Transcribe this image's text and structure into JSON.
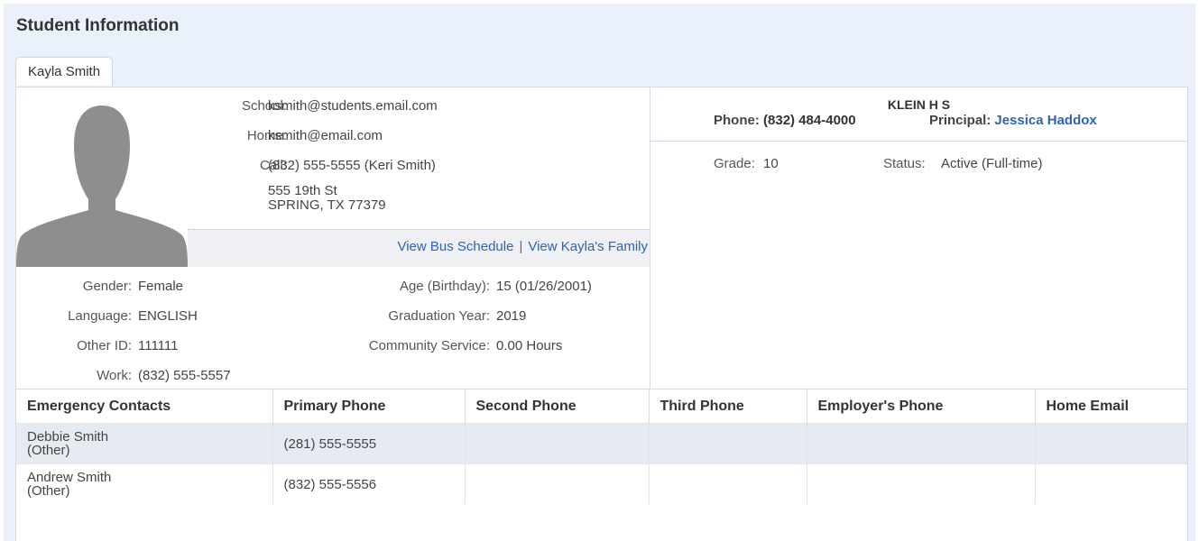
{
  "page_title": "Student Information",
  "tab": {
    "label": "Kayla Smith"
  },
  "contact": {
    "school_label": "School:",
    "school_value": "ksmith@students.email.com",
    "home_label": "Home:",
    "home_value": "ksmith@email.com",
    "call_label": "Call:",
    "call_value": "(832) 555-5555 (Keri Smith)",
    "address_line1": "555 19th St",
    "address_line2": "SPRING, TX 77379"
  },
  "links": {
    "bus_schedule": "View Bus Schedule",
    "separator": "|",
    "family": "View Kayla's Family"
  },
  "demographics": {
    "gender_label": "Gender:",
    "gender_value": "Female",
    "language_label": "Language:",
    "language_value": "ENGLISH",
    "other_id_label": "Other ID:",
    "other_id_value": "111111",
    "work_label": "Work:",
    "work_value": "(832) 555-5557",
    "age_label": "Age (Birthday):",
    "age_value": "15 (01/26/2001)",
    "grad_label": "Graduation Year:",
    "grad_value": "2019",
    "service_label": "Community Service:",
    "service_value": "0.00 Hours"
  },
  "school": {
    "name": "KLEIN H S",
    "phone_label": "Phone:",
    "phone_value": "(832) 484-4000",
    "principal_label": "Principal:",
    "principal_value": "Jessica Haddox"
  },
  "enrollment": {
    "grade_label": "Grade:",
    "grade_value": "10",
    "status_label": "Status:",
    "status_value": "Active (Full-time)"
  },
  "contacts_table": {
    "headers": [
      "Emergency Contacts",
      "Primary Phone",
      "Second Phone",
      "Third Phone",
      "Employer's Phone",
      "Home Email"
    ],
    "rows": [
      {
        "name": "Debbie Smith",
        "relation": "(Other)",
        "primary": "(281) 555-5555",
        "second": "",
        "third": "",
        "employer": "",
        "email": ""
      },
      {
        "name": "Andrew Smith",
        "relation": "(Other)",
        "primary": "(832) 555-5556",
        "second": "",
        "third": "",
        "employer": "",
        "email": ""
      }
    ]
  },
  "icons": {
    "avatar": "person-silhouette-icon"
  },
  "colors": {
    "link": "#2f63b3",
    "header_bg": "#eaf1fa",
    "row_shade": "#e6ebf2"
  }
}
